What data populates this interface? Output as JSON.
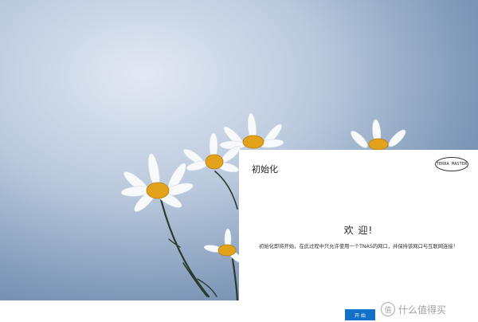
{
  "panel": {
    "title": "初始化",
    "logo_text": "TERRA MASTER",
    "welcome": "欢 迎!",
    "description": "初始化即将开始，在此过程中只允许使用一个TNAS的网口，并保持该网口与互联网连接！",
    "start_button": "开 始"
  },
  "watermark": {
    "icon_glyph": "值",
    "text": "什么值得买"
  }
}
